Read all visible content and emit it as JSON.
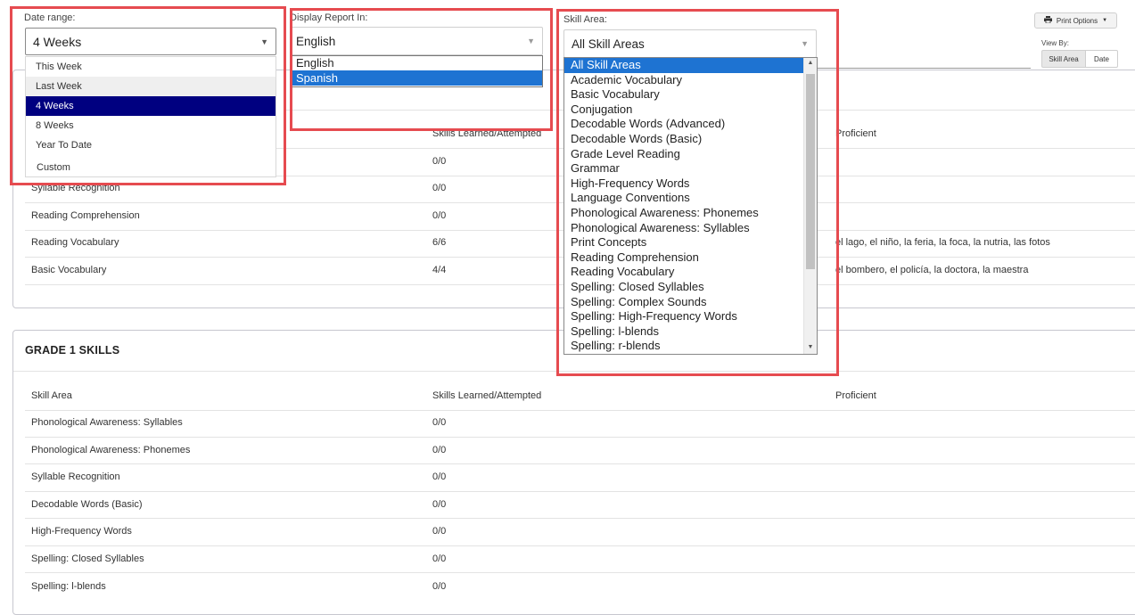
{
  "filters": {
    "date_range": {
      "label": "Date range:",
      "selected": "4 Weeks",
      "options": [
        "This Week",
        "Last Week",
        "4 Weeks",
        "8 Weeks",
        "Year To Date",
        "Custom"
      ]
    },
    "display_report": {
      "label": "Display Report In:",
      "selected": "English",
      "options": [
        "English",
        "Spanish"
      ]
    },
    "skill_area": {
      "label": "Skill Area:",
      "selected": "All Skill Areas",
      "options": [
        "All Skill Areas",
        "Academic Vocabulary",
        "Basic Vocabulary",
        "Conjugation",
        "Decodable Words (Advanced)",
        "Decodable Words (Basic)",
        "Grade Level Reading",
        "Grammar",
        "High-Frequency Words",
        "Language Conventions",
        "Phonological Awareness: Phonemes",
        "Phonological Awareness: Syllables",
        "Print Concepts",
        "Reading Comprehension",
        "Reading Vocabulary",
        "Spelling: Closed Syllables",
        "Spelling: Complex Sounds",
        "Spelling: High-Frequency Words",
        "Spelling: l-blends",
        "Spelling: r-blends"
      ]
    }
  },
  "toolbar": {
    "print_options": "Print Options",
    "view_by_label": "View By:",
    "view_skill_area": "Skill Area",
    "view_date": "Date"
  },
  "kinder_table": {
    "headers": {
      "learned": "Skills Learned/Attempted",
      "proficient": "Proficient"
    },
    "rows": [
      {
        "skill": "",
        "learned": "0/0",
        "proficient": ""
      },
      {
        "skill": "Syllable Recognition",
        "learned": "0/0",
        "proficient": ""
      },
      {
        "skill": "Reading Comprehension",
        "learned": "0/0",
        "proficient": ""
      },
      {
        "skill": "Reading Vocabulary",
        "learned": "6/6",
        "proficient": "el lago, el niño, la feria, la foca, la nutria, las fotos"
      },
      {
        "skill": "Basic Vocabulary",
        "learned": "4/4",
        "proficient": "el bombero, el policía, la doctora, la maestra"
      }
    ]
  },
  "grade1": {
    "title": "GRADE 1 SKILLS",
    "headers": {
      "skill": "Skill Area",
      "learned": "Skills Learned/Attempted",
      "proficient": "Proficient"
    },
    "rows": [
      {
        "skill": "Phonological Awareness: Syllables",
        "learned": "0/0"
      },
      {
        "skill": "Phonological Awareness: Phonemes",
        "learned": "0/0"
      },
      {
        "skill": "Syllable Recognition",
        "learned": "0/0"
      },
      {
        "skill": "Decodable Words (Basic)",
        "learned": "0/0"
      },
      {
        "skill": "High-Frequency Words",
        "learned": "0/0"
      },
      {
        "skill": "Spelling: Closed Syllables",
        "learned": "0/0"
      },
      {
        "skill": "Spelling: l-blends",
        "learned": "0/0"
      }
    ]
  },
  "colors": {
    "highlight_red": "#e64b50",
    "selected_navy": "#000080",
    "selected_blue": "#1e73d2"
  }
}
